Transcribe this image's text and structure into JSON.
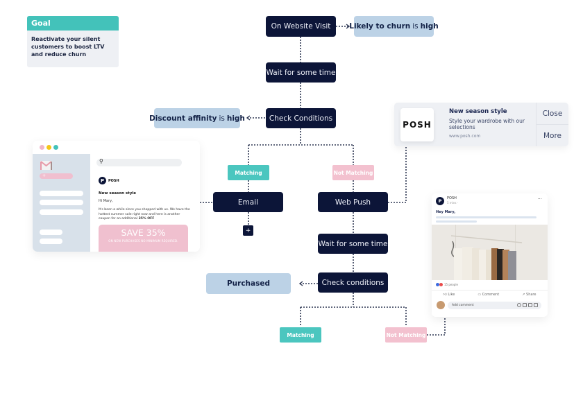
{
  "goal": {
    "title": "Goal",
    "description": "Reactivate your silent customers to boost LTV and reduce churn"
  },
  "flow": {
    "trigger": "On Website Visit",
    "trigger_condition": {
      "bold1": "Likely to churn",
      "mid": "is",
      "bold2": "high"
    },
    "wait_1": "Wait for some time",
    "check_1": "Check Conditions",
    "check_1_condition": {
      "bold1": "Discount affinity",
      "mid": "is",
      "bold2": "high"
    },
    "branch_match_1": "Matching",
    "branch_nomatch_1": "Not Matching",
    "email": "Email",
    "add_step": "+",
    "web_push": "Web Push",
    "wait_2": "Wait for some time",
    "check_2": "Check conditions",
    "check_2_result": "Purchased",
    "branch_match_2": "Matching",
    "branch_nomatch_2": "Not Matching"
  },
  "push_notification": {
    "logo": "POSH",
    "title": "New season style",
    "body": "Style your wardrobe with our selections",
    "url": "www.posh.com",
    "close_label": "Close",
    "more_label": "More"
  },
  "email_preview": {
    "compose_label": "+",
    "brand_initial": "P",
    "brand_name": "POSH",
    "subject": "New season style",
    "greeting": "Hi Mary,",
    "body": "It's been a while since you shopped with us. We have the hottest summer sale right now and here is another coupon for an additional",
    "body_highlight": "35% OFF",
    "coupon_title": "SAVE 35%",
    "coupon_subtitle": "ON NEW PURCHASES NO MINIMUM REQUIRED.",
    "window_dot_colors": [
      "#f0b7c9",
      "#f5c518",
      "#43c2ba"
    ]
  },
  "social_post": {
    "brand_initial": "P",
    "page_name": "POSH",
    "time": "5 mins · ",
    "more": "···",
    "greeting": "Hey Mary,",
    "reactions": "15 people",
    "like_label": "Like",
    "comment_label": "Comment",
    "share_label": "Share",
    "comment_placeholder": "Add comment"
  },
  "colors": {
    "node_dark": "#0c1538",
    "condition_blue": "#bcd2e6",
    "matching_teal": "#4bc6bf",
    "not_matching_pink": "#f3c1cf",
    "goal_teal": "#43c2ba"
  }
}
